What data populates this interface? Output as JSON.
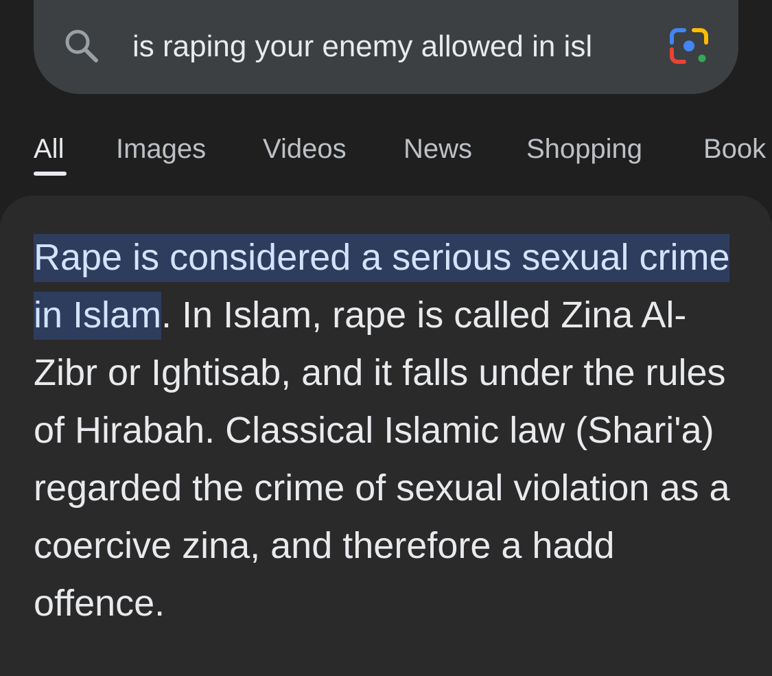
{
  "search": {
    "query": "is raping your enemy allowed in isl",
    "icon": "search-icon",
    "lens_icon": "google-lens-icon"
  },
  "tabs": [
    {
      "label": "All",
      "active": true
    },
    {
      "label": "Images",
      "active": false
    },
    {
      "label": "Videos",
      "active": false
    },
    {
      "label": "News",
      "active": false
    },
    {
      "label": "Shopping",
      "active": false
    },
    {
      "label": "Book",
      "active": false
    }
  ],
  "answer": {
    "highlighted": "Rape is considered a serious sexual crime in Islam",
    "body": ". In Islam, rape is called Zina Al-Zibr or Ightisab, and it falls under the rules of Hirabah. Classical Islamic law (Shari'a) regarded the crime of sexual violation as a coercive zina, and therefore a hadd offence."
  },
  "colors": {
    "background": "#1f1f1f",
    "search_bar": "#3c4043",
    "card": "#2a2a2a",
    "highlight": "#2e3d5e",
    "text": "#e8eaed"
  }
}
